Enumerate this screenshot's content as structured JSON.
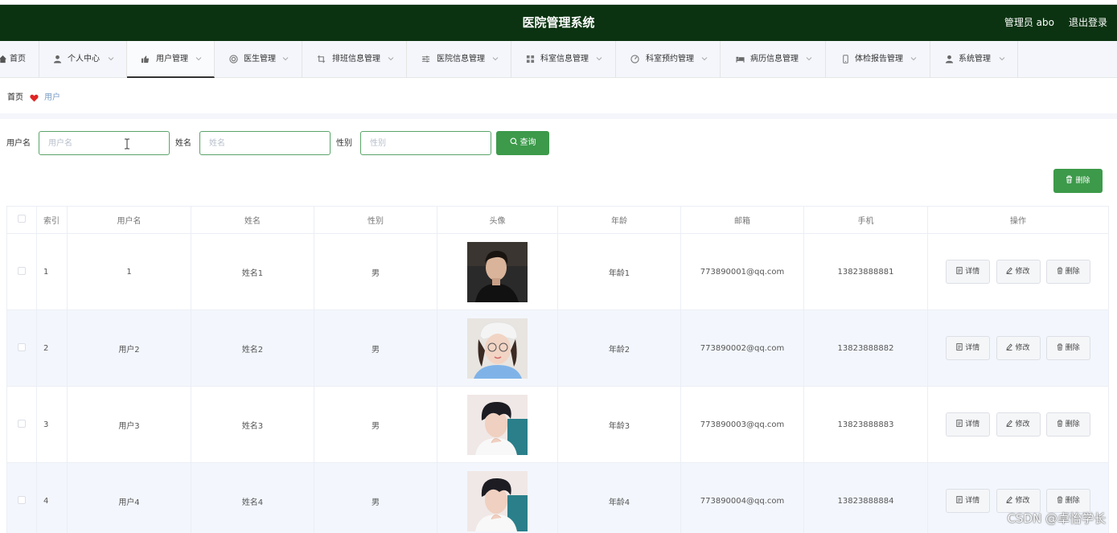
{
  "header": {
    "title": "医院管理系统",
    "user": "管理员 abo",
    "logout": "退出登录"
  },
  "nav": {
    "items": [
      {
        "label": "首页",
        "icon": "home-icon"
      },
      {
        "label": "个人中心",
        "icon": "person-icon"
      },
      {
        "label": "用户管理",
        "icon": "thumb-icon"
      },
      {
        "label": "医生管理",
        "icon": "lifebuoy-icon"
      },
      {
        "label": "排班信息管理",
        "icon": "crop-icon"
      },
      {
        "label": "医院信息管理",
        "icon": "sliders-icon"
      },
      {
        "label": "科室信息管理",
        "icon": "grid-icon"
      },
      {
        "label": "科室预约管理",
        "icon": "gauge-icon"
      },
      {
        "label": "病历信息管理",
        "icon": "bed-icon"
      },
      {
        "label": "体检报告管理",
        "icon": "mobile-icon"
      },
      {
        "label": "系统管理",
        "icon": "person-icon"
      }
    ]
  },
  "breadcrumb": {
    "home": "首页",
    "current": "用户"
  },
  "search": {
    "username_label": "用户名",
    "username_placeholder": "用户名",
    "name_label": "姓名",
    "name_placeholder": "姓名",
    "gender_label": "性别",
    "gender_placeholder": "性别",
    "query_button": "查询"
  },
  "toolbar": {
    "delete_button": "删除"
  },
  "table": {
    "columns": [
      "索引",
      "用户名",
      "姓名",
      "性别",
      "头像",
      "年龄",
      "邮箱",
      "手机",
      "操作"
    ],
    "actions": {
      "detail": "详情",
      "edit": "修改",
      "delete": "删除"
    },
    "rows": [
      {
        "index": "1",
        "username": "1",
        "name": "姓名1",
        "gender": "男",
        "age": "年龄1",
        "email": "773890001@qq.com",
        "phone": "13823888881"
      },
      {
        "index": "2",
        "username": "用户2",
        "name": "姓名2",
        "gender": "男",
        "age": "年龄2",
        "email": "773890002@qq.com",
        "phone": "13823888882"
      },
      {
        "index": "3",
        "username": "用户3",
        "name": "姓名3",
        "gender": "男",
        "age": "年龄3",
        "email": "773890003@qq.com",
        "phone": "13823888883"
      },
      {
        "index": "4",
        "username": "用户4",
        "name": "姓名4",
        "gender": "男",
        "age": "年龄4",
        "email": "773890004@qq.com",
        "phone": "13823888884"
      }
    ]
  },
  "watermark": "CSDN @卓怡学长",
  "colors": {
    "header_bg": "#0b3311",
    "accent_green": "#3c9a4a",
    "row_alt": "#f3f7fd"
  }
}
